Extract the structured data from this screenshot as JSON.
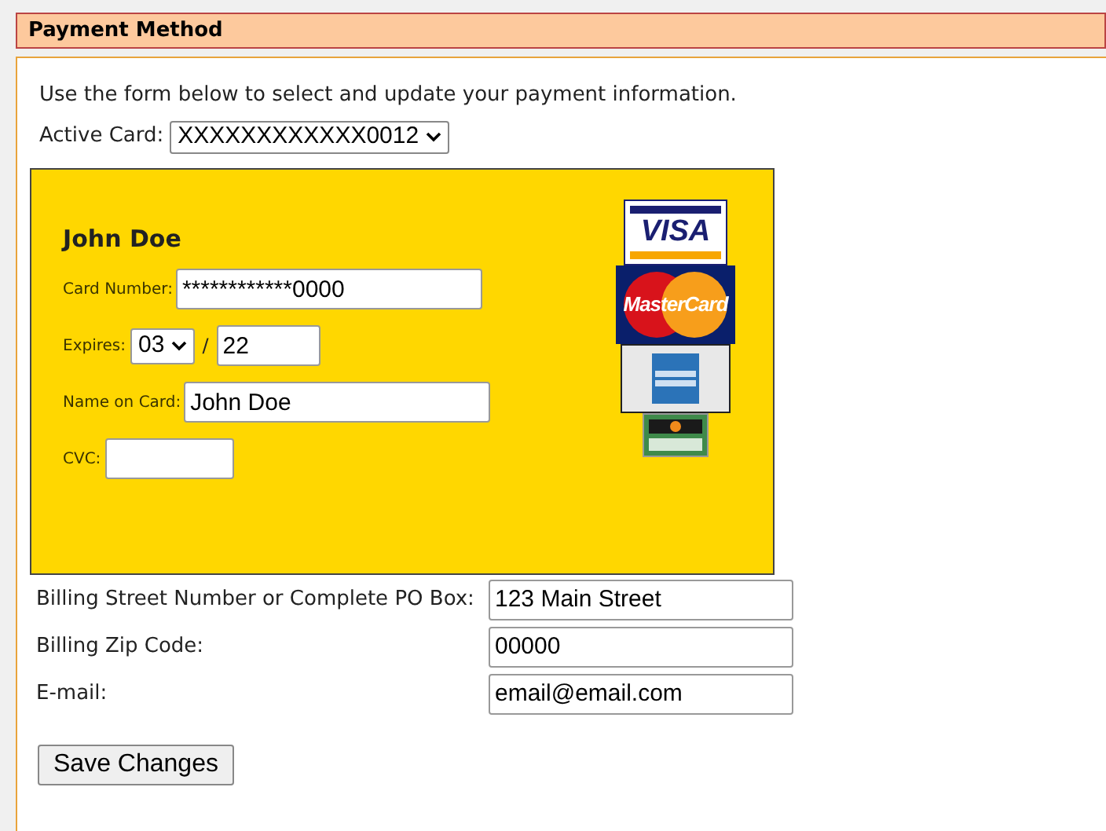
{
  "header": {
    "title": "Payment Method"
  },
  "intro": "Use the form below to select and update your payment information.",
  "active_card": {
    "label": "Active Card:",
    "value": "XXXXXXXXXXXX0012"
  },
  "card": {
    "holder": "John Doe",
    "fields": [
      {
        "kind": "text",
        "label": "Card Number:",
        "value": "************0000"
      },
      {
        "kind": "expiry",
        "label": "Expires:",
        "month": "03",
        "separator": "/",
        "year": "22"
      },
      {
        "kind": "text",
        "label": "Name on Card:",
        "value": "John Doe"
      },
      {
        "kind": "short",
        "label": "CVC:"
      }
    ],
    "logos": [
      {
        "kind": "visa",
        "text": "VISA"
      },
      {
        "kind": "mastercard",
        "text": "MasterCard"
      },
      {
        "kind": "amex"
      },
      {
        "kind": "discover"
      }
    ]
  },
  "billing": [
    {
      "label": "Billing Street Number or Complete PO Box:",
      "value": "123 Main Street"
    },
    {
      "label": "Billing Zip Code:",
      "value": "00000"
    },
    {
      "label": "E-mail:",
      "value": "email@email.com"
    }
  ],
  "save_button": "Save Changes"
}
